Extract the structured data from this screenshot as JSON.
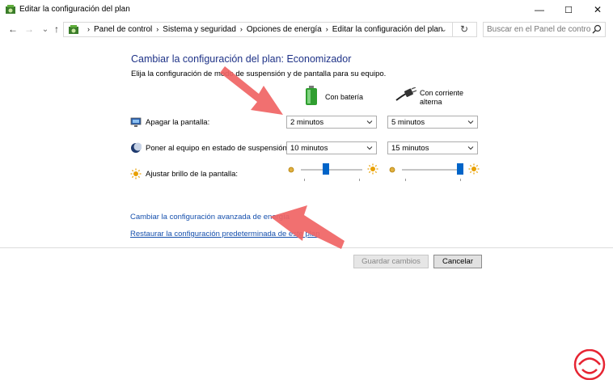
{
  "window": {
    "title": "Editar la configuración del plan",
    "controls": {
      "minimize": "—",
      "maximize": "☐",
      "close": "✕"
    }
  },
  "nav": {
    "back": "←",
    "forward": "→",
    "recent": "⌄",
    "up": "↑",
    "refresh": "↻"
  },
  "breadcrumb": [
    "Panel de control",
    "Sistema y seguridad",
    "Opciones de energía",
    "Editar la configuración del plan"
  ],
  "search": {
    "placeholder": "Buscar en el Panel de control"
  },
  "main": {
    "heading": "Cambiar la configuración del plan: Economizador",
    "subtitle": "Elija la configuración de modo de suspensión y de pantalla para su equipo.",
    "columns": {
      "battery": "Con batería",
      "ac_line1": "Con corriente",
      "ac_line2": "alterna"
    },
    "rows": {
      "display_off": {
        "label": "Apagar la pantalla:",
        "battery": "2 minutos",
        "ac": "5 minutos"
      },
      "sleep": {
        "label": "Poner al equipo en estado de suspensión:",
        "battery": "10 minutos",
        "ac": "15 minutos"
      },
      "brightness": {
        "label": "Ajustar brillo de la pantalla:",
        "battery_level_pct": 40,
        "ac_level_pct": 100
      }
    },
    "links": {
      "advanced": "Cambiar la configuración avanzada de energía",
      "restore": "Restaurar la configuración predeterminada de este plan"
    }
  },
  "buttons": {
    "save": "Guardar cambios",
    "cancel": "Cancelar"
  },
  "colors": {
    "heading": "#1e3287",
    "link": "#1650ad",
    "slider_thumb": "#0064c8",
    "annotation_arrow": "#f06464",
    "logo": "#e62432"
  },
  "icons": [
    "control-panel-icon",
    "monitor-icon",
    "moon-icon",
    "sun-icon",
    "battery-icon",
    "power-plug-icon",
    "search-icon",
    "chevron-down-icon",
    "refresh-icon"
  ]
}
